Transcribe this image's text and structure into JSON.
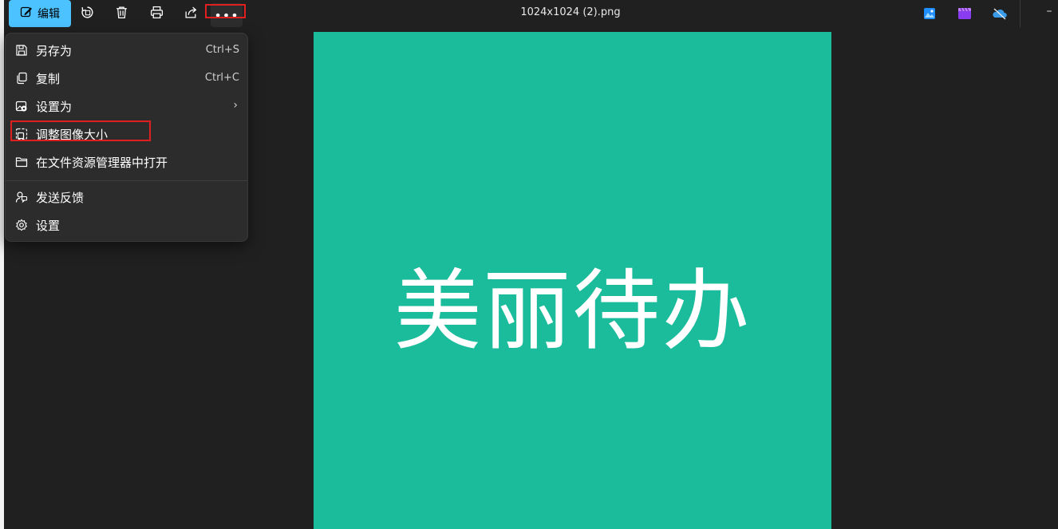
{
  "titlebar": {
    "edit_label": "编辑",
    "file_name": "1024x1024 (2).png",
    "more_label": "•••",
    "minimize_label": "–",
    "icons": [
      "rotate-icon",
      "delete-icon",
      "print-icon",
      "share-icon",
      "more-icon",
      "photos-icon",
      "clipchamp-icon",
      "onedrive-icon"
    ]
  },
  "menu": {
    "items": [
      {
        "label": "另存为",
        "shortcut": "Ctrl+S",
        "icon": "save-icon"
      },
      {
        "label": "复制",
        "shortcut": "Ctrl+C",
        "icon": "copy-icon"
      },
      {
        "label": "设置为",
        "chevron": "›",
        "icon": "set-as-icon"
      },
      {
        "label": "调整图像大小",
        "icon": "resize-icon"
      },
      {
        "label": "在文件资源管理器中打开",
        "icon": "folder-icon"
      },
      {
        "label": "发送反馈",
        "icon": "feedback-icon"
      },
      {
        "label": "设置",
        "icon": "gear-icon"
      }
    ]
  },
  "image": {
    "text": "美丽待办",
    "background": "#1bbc9b"
  },
  "colors": {
    "accent": "#4cc2ff",
    "highlight_box": "#e02020",
    "app_bg": "#202020",
    "menu_bg": "#2c2c2c"
  }
}
